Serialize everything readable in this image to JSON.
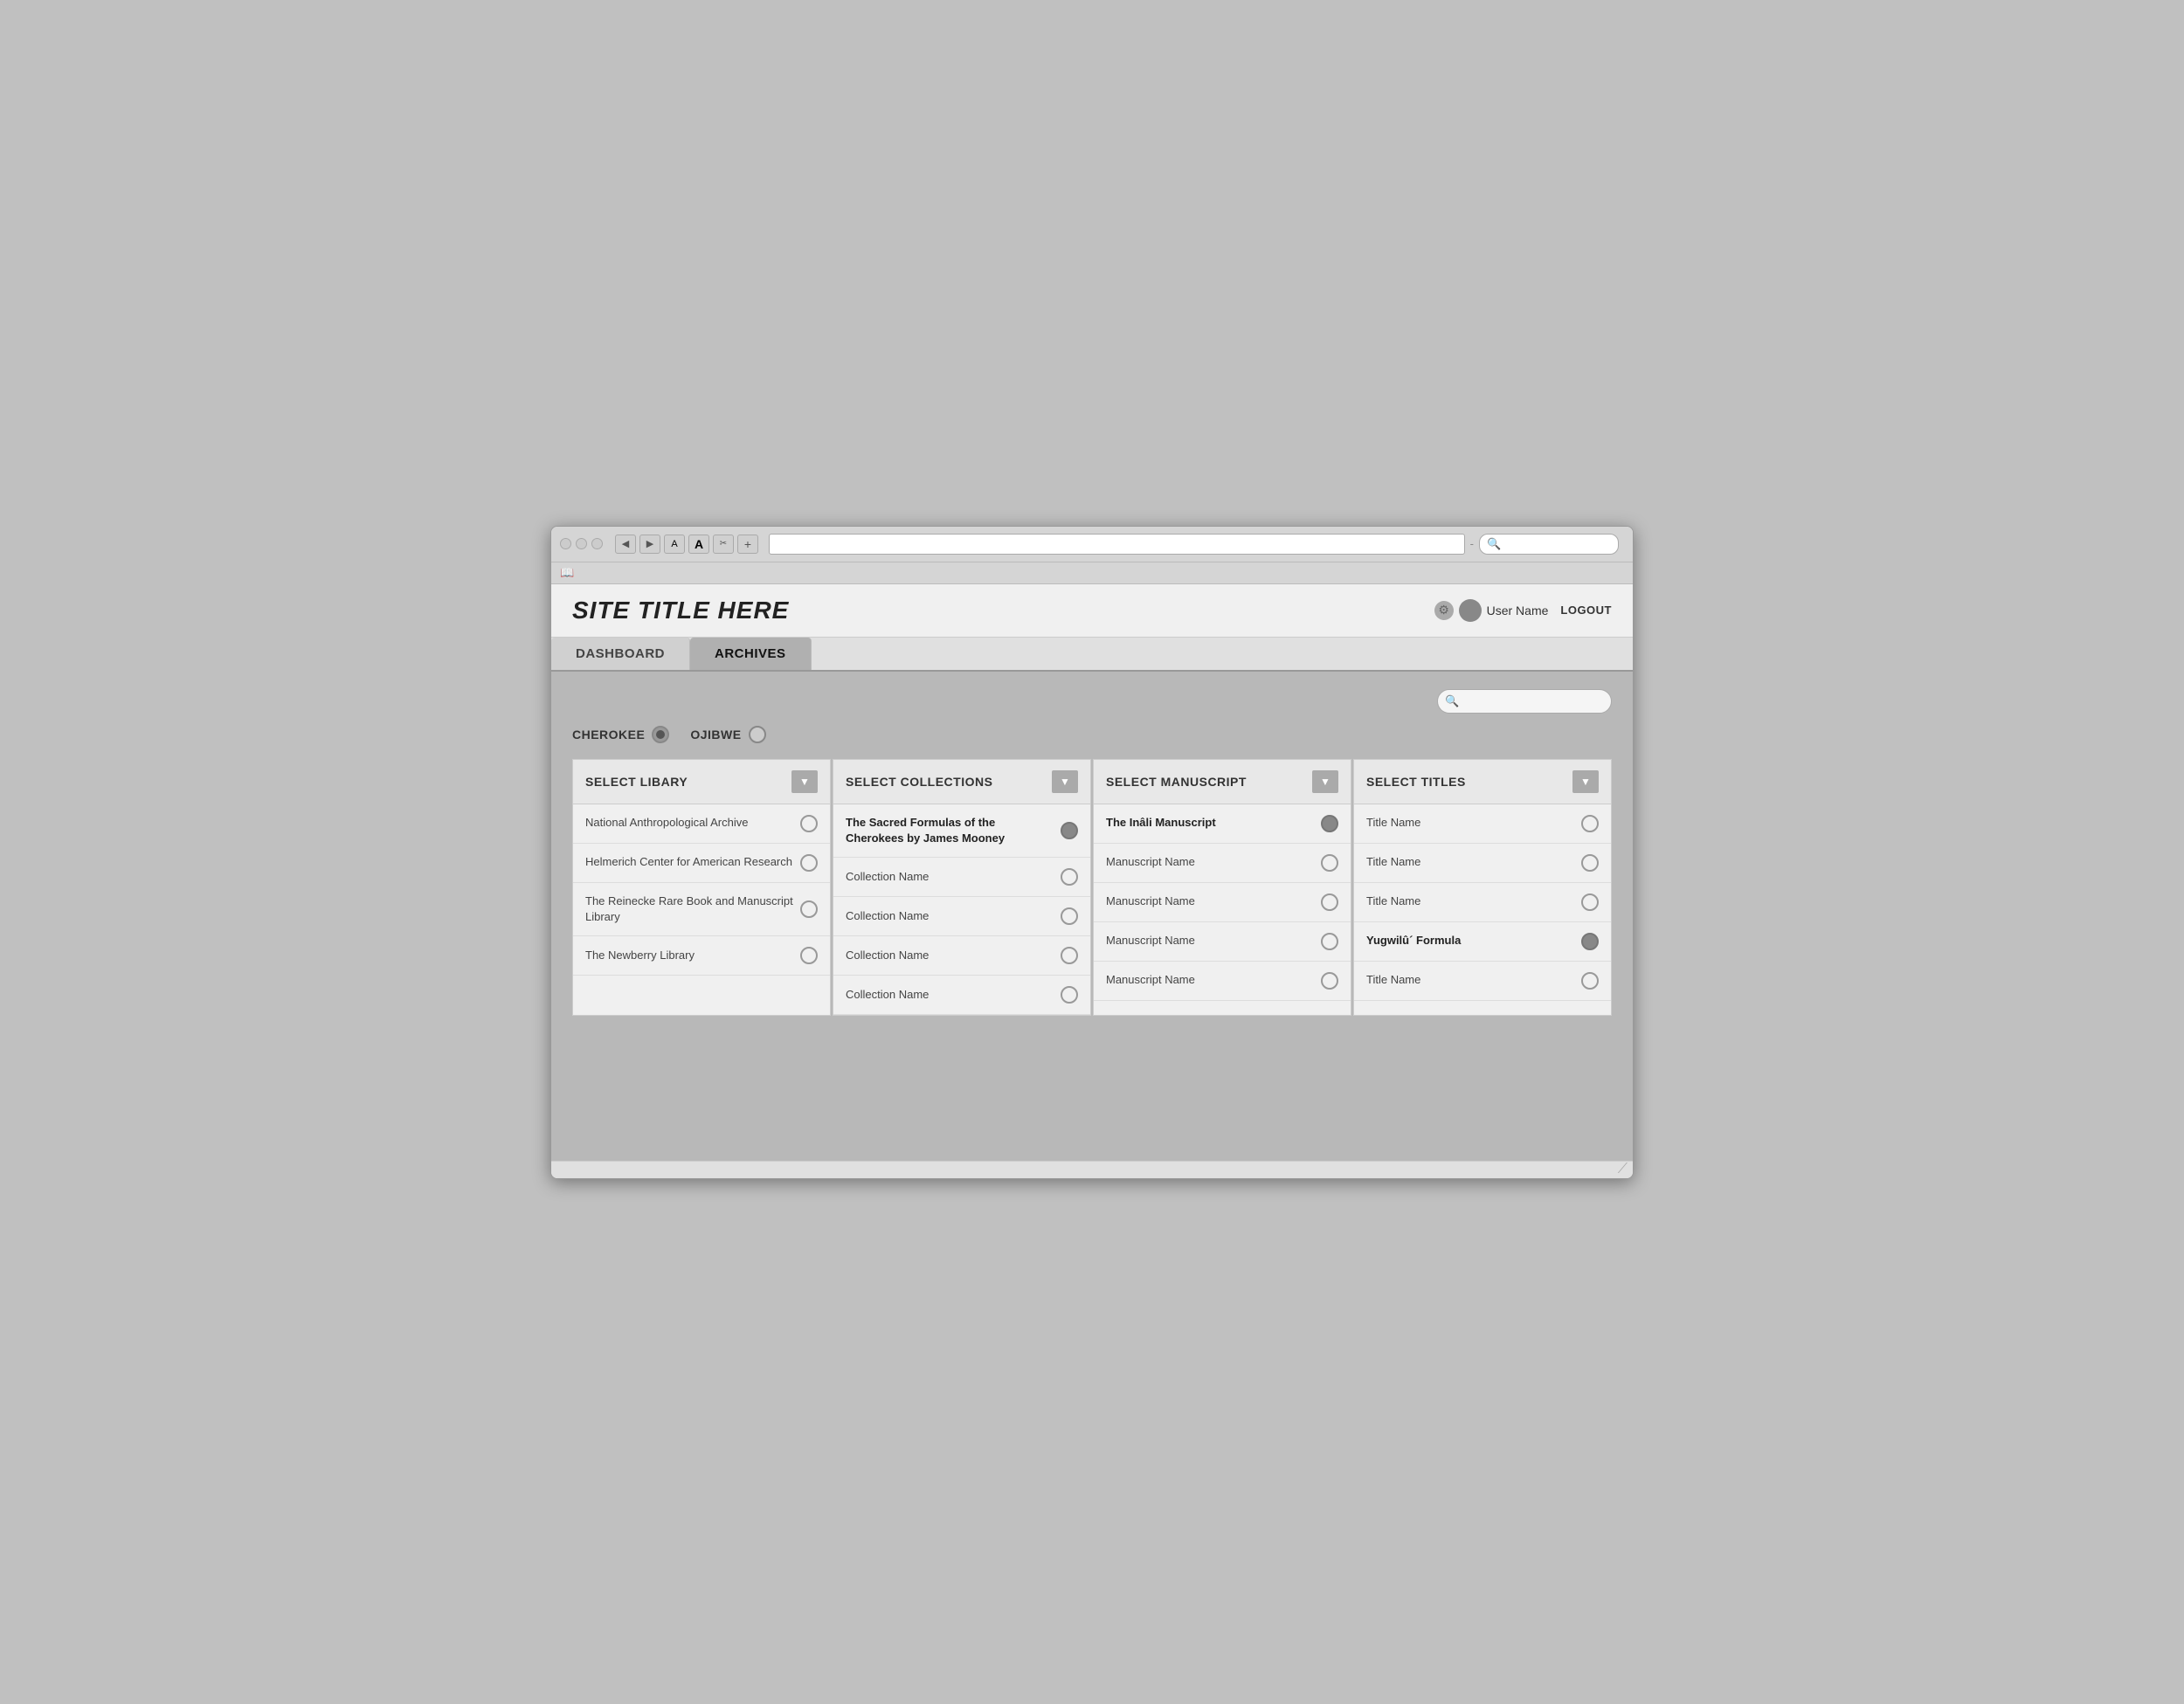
{
  "browser": {
    "traffic_lights": [
      "close",
      "minimize",
      "maximize"
    ],
    "nav_buttons": [
      "◀",
      "▶"
    ],
    "font_buttons": [
      "A",
      "A"
    ],
    "other_buttons": [
      "✂",
      "+"
    ],
    "address": "",
    "search_placeholder": "🔍",
    "bookmark_icon": "📖"
  },
  "header": {
    "site_title": "SITE TITLE HERE",
    "user_name": "User Name",
    "logout_label": "LOGOUT"
  },
  "nav": {
    "tabs": [
      {
        "id": "dashboard",
        "label": "DASHBOARD",
        "active": false
      },
      {
        "id": "archives",
        "label": "ARCHIVES",
        "active": true
      }
    ]
  },
  "content": {
    "search_placeholder": "🔍",
    "languages": [
      {
        "id": "cherokee",
        "label": "CHEROKEE",
        "selected": true
      },
      {
        "id": "ojibwe",
        "label": "OJIBWE",
        "selected": false
      }
    ],
    "columns": [
      {
        "id": "library",
        "header": "SELECT LIBARY",
        "rows": [
          {
            "text": "National Anthropological Archive",
            "selected": false,
            "bold": false
          },
          {
            "text": "Helmerich Center for American Research",
            "selected": false,
            "bold": false
          },
          {
            "text": "The Reinecke Rare Book and Manuscript Library",
            "selected": false,
            "bold": false
          },
          {
            "text": "The Newberry Library",
            "selected": false,
            "bold": false
          }
        ]
      },
      {
        "id": "collections",
        "header": "SELECT COLLECTIONS",
        "rows": [
          {
            "text": "The Sacred Formulas of the Cherokees by James Mooney",
            "selected": true,
            "bold": true
          },
          {
            "text": "Collection Name",
            "selected": false,
            "bold": false
          },
          {
            "text": "Collection Name",
            "selected": false,
            "bold": false
          },
          {
            "text": "Collection Name",
            "selected": false,
            "bold": false
          },
          {
            "text": "Collection Name",
            "selected": false,
            "bold": false
          }
        ]
      },
      {
        "id": "manuscript",
        "header": "SELECT MANUSCRIPT",
        "rows": [
          {
            "text": "The Inâli Manuscript",
            "selected": true,
            "bold": true
          },
          {
            "text": "Manuscript Name",
            "selected": false,
            "bold": false
          },
          {
            "text": "Manuscript Name",
            "selected": false,
            "bold": false
          },
          {
            "text": "Manuscript Name",
            "selected": false,
            "bold": false
          },
          {
            "text": "Manuscript Name",
            "selected": false,
            "bold": false
          }
        ]
      },
      {
        "id": "titles",
        "header": "SELECT TITLES",
        "rows": [
          {
            "text": "Title Name",
            "selected": false,
            "bold": false
          },
          {
            "text": "Title Name",
            "selected": false,
            "bold": false
          },
          {
            "text": "Title Name",
            "selected": false,
            "bold": false
          },
          {
            "text": "Yugwilû´ Formula",
            "selected": true,
            "bold": true
          },
          {
            "text": "Title Name",
            "selected": false,
            "bold": false
          }
        ]
      }
    ]
  }
}
